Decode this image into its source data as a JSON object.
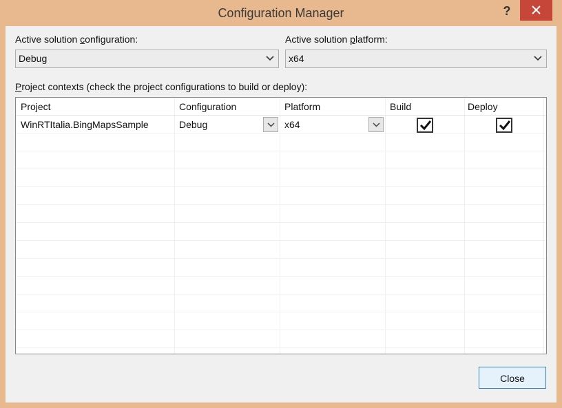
{
  "window": {
    "title": "Configuration Manager",
    "help_label": "?"
  },
  "solution_config": {
    "label_pre": "Active solution ",
    "label_accel": "c",
    "label_post": "onfiguration:",
    "value": "Debug"
  },
  "solution_platform": {
    "label_pre": "Active solution ",
    "label_accel": "p",
    "label_post": "latform:",
    "value": "x64"
  },
  "contexts": {
    "label_accel": "P",
    "label_post": "roject contexts (check the project configurations to build or deploy):"
  },
  "grid": {
    "columns": [
      "Project",
      "Configuration",
      "Platform",
      "Build",
      "Deploy"
    ],
    "rows": [
      {
        "project": "WinRTItalia.BingMapsSample",
        "configuration": "Debug",
        "platform": "x64",
        "build": true,
        "deploy": true
      }
    ]
  },
  "buttons": {
    "close": "Close"
  },
  "colors": {
    "title_bg": "#e8b88e",
    "close_x": "#c7463a",
    "default_button_border": "#3c7fb1"
  }
}
